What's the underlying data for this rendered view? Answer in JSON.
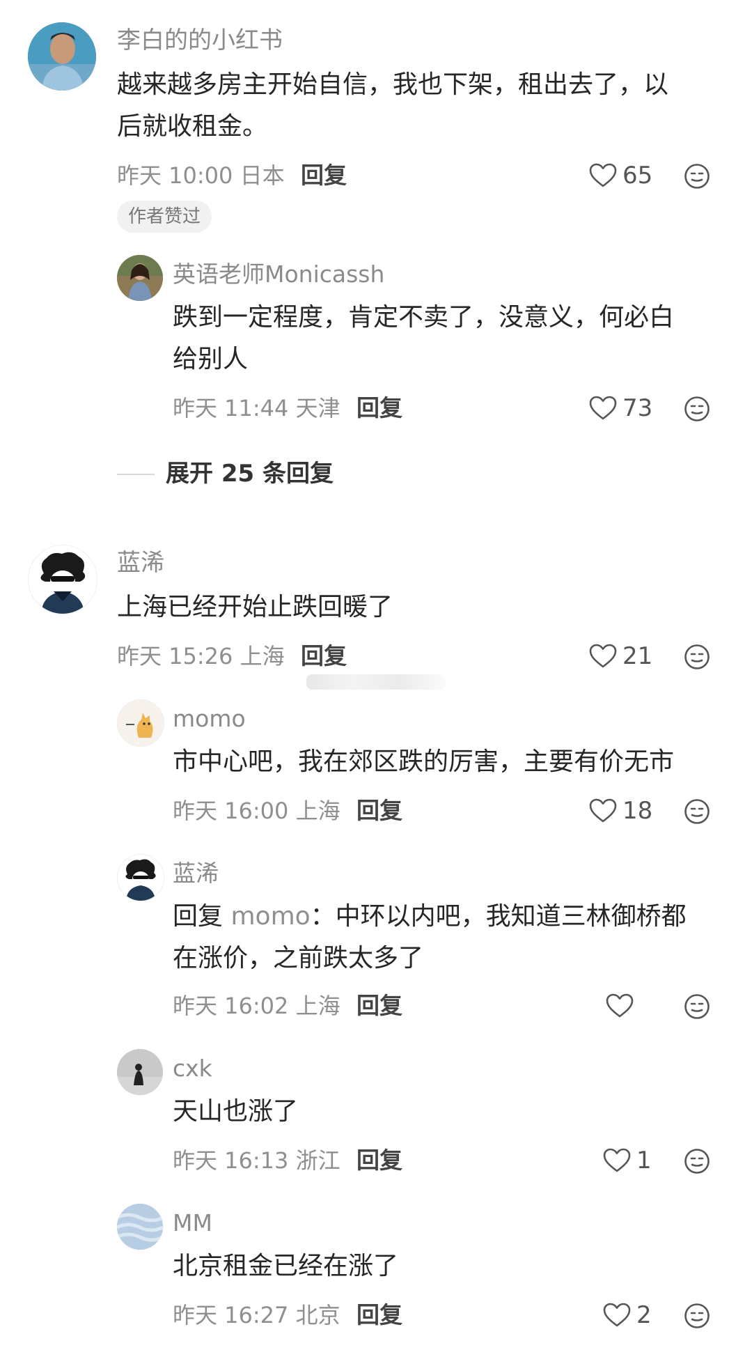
{
  "comments": [
    {
      "username": "李白的的小红书",
      "text_line1": "越来越多房主开始自信，我也下架，租出去了，以",
      "text_line2": "后就收租金。",
      "meta": "昨天 10:00 日本",
      "reply_label": "回复",
      "likes": "65",
      "badge": "作者赞过",
      "replies": [
        {
          "username": "英语老师Monicassh",
          "text_line1": "跌到一定程度，肯定不卖了，没意义，何必白",
          "text_line2": "给别人",
          "meta": "昨天 11:44 天津",
          "reply_label": "回复",
          "likes": "73"
        }
      ],
      "expand_label": "展开 25 条回复"
    },
    {
      "username": "蓝浠",
      "text_line1": "上海已经开始止跌回暖了",
      "meta": "昨天 15:26 上海",
      "reply_label": "回复",
      "likes": "21",
      "replies": [
        {
          "username": "momo",
          "text_line1": "市中心吧，我在郊区跌的厉害，主要有价无市",
          "meta": "昨天 16:00 上海",
          "reply_label": "回复",
          "likes": "18"
        },
        {
          "username": "蓝浠",
          "reply_prefix": "回复",
          "mention": "momo",
          "text_line1_rest": "：中环以内吧，我知道三林御桥都",
          "text_line2": "在涨价，之前跌太多了",
          "meta": "昨天 16:02 上海",
          "reply_label": "回复",
          "likes": ""
        },
        {
          "username": "cxk",
          "text_line1": "天山也涨了",
          "meta": "昨天 16:13 浙江",
          "reply_label": "回复",
          "likes": "1"
        },
        {
          "username": "MM",
          "text_line1": "北京租金已经在涨了",
          "meta": "昨天 16:27 北京",
          "reply_label": "回复",
          "likes": "2"
        }
      ]
    }
  ],
  "icons": {
    "like": "heart-outline-icon",
    "react": "emoji-face-icon"
  },
  "colors": {
    "text": "#262626",
    "meta": "#8f8f8f",
    "badge_bg": "#f1f1f1"
  }
}
